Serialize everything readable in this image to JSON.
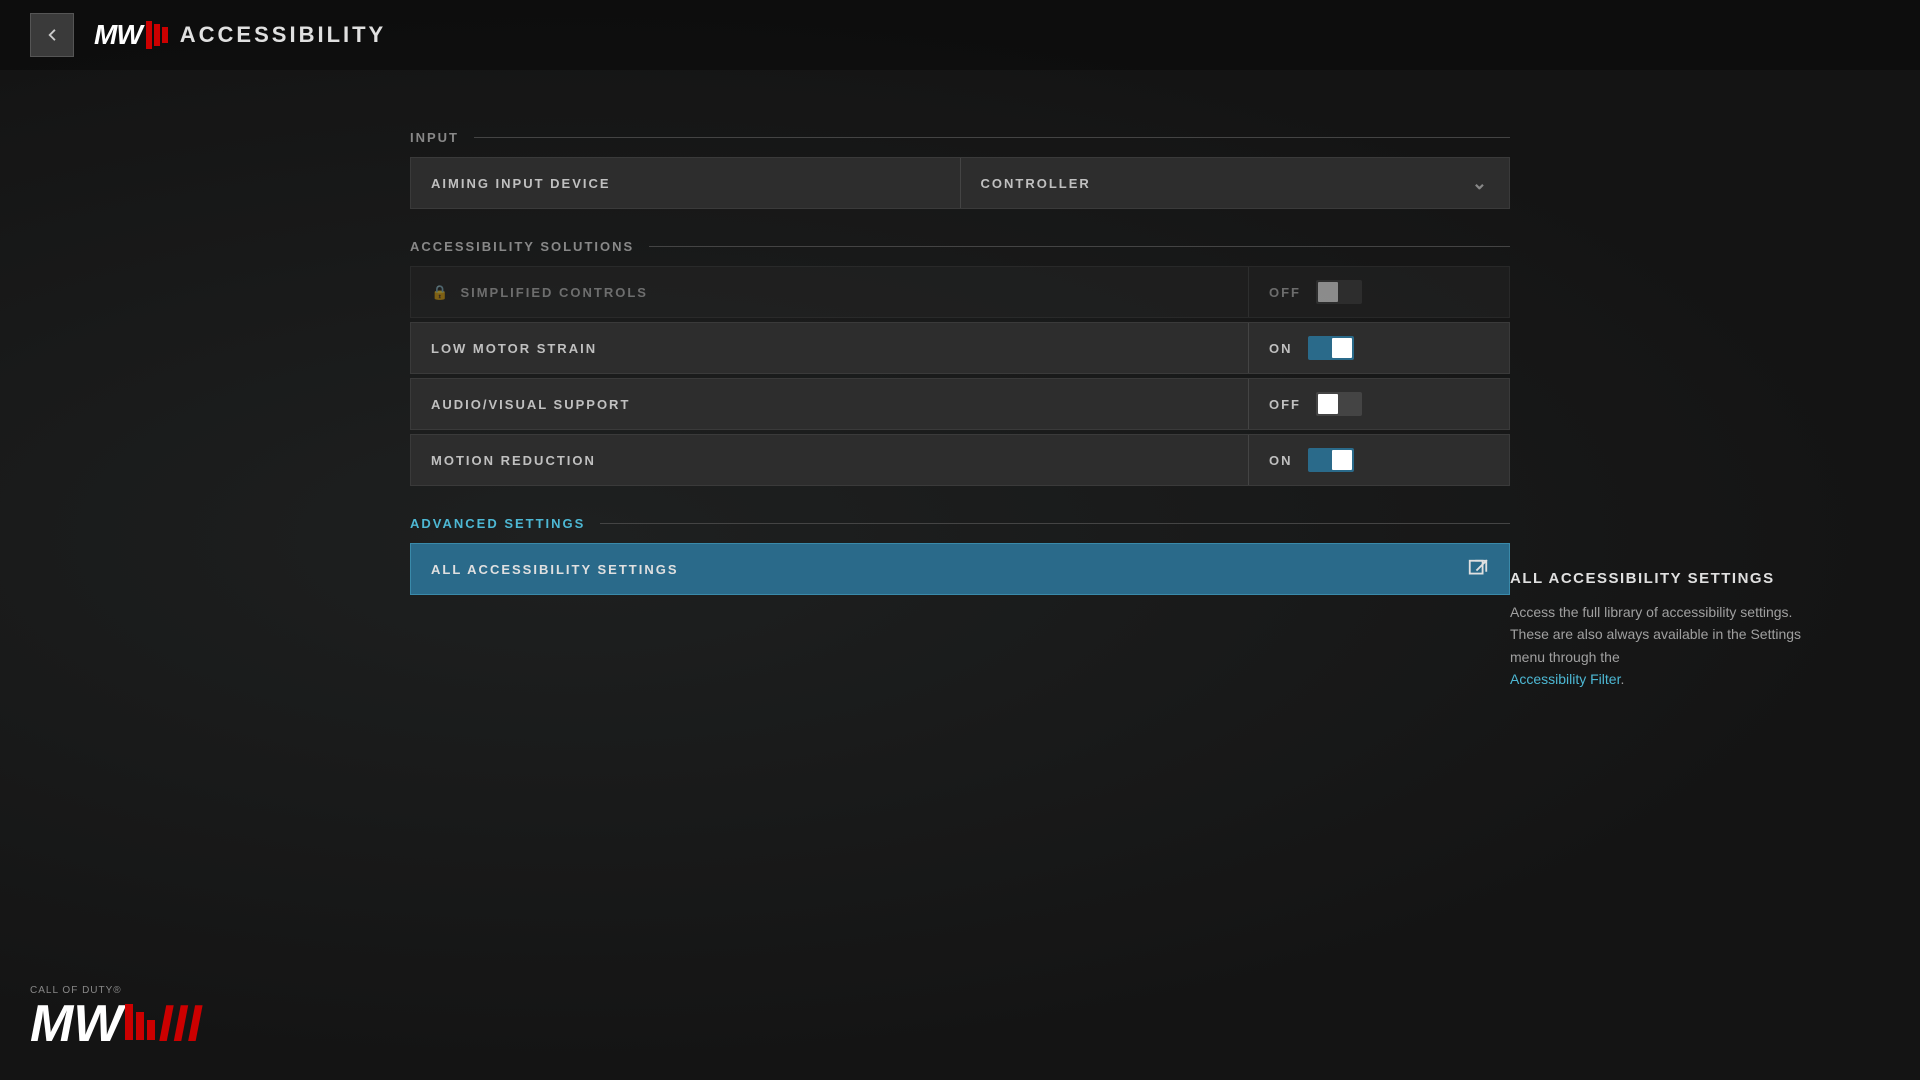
{
  "header": {
    "back_label": "←",
    "game_title": "MW",
    "page_title": "ACCESSIBILITY"
  },
  "sections": {
    "input": {
      "label": "INPUT",
      "settings": [
        {
          "name": "AIMING INPUT DEVICE",
          "value": "CONTROLLER",
          "type": "dropdown",
          "disabled": false
        }
      ]
    },
    "accessibility_solutions": {
      "label": "ACCESSIBILITY SOLUTIONS",
      "settings": [
        {
          "name": "SIMPLIFIED CONTROLS",
          "value": "OFF",
          "type": "toggle",
          "state": "off",
          "disabled": true,
          "locked": true
        },
        {
          "name": "LOW MOTOR STRAIN",
          "value": "ON",
          "type": "toggle",
          "state": "on",
          "disabled": false,
          "locked": false
        },
        {
          "name": "AUDIO/VISUAL SUPPORT",
          "value": "OFF",
          "type": "toggle",
          "state": "off",
          "disabled": false,
          "locked": false
        },
        {
          "name": "MOTION REDUCTION",
          "value": "ON",
          "type": "toggle",
          "state": "on",
          "disabled": false,
          "locked": false
        }
      ]
    },
    "advanced": {
      "label": "ADVANCED SETTINGS",
      "nav_items": [
        {
          "name": "ALL ACCESSIBILITY SETTINGS",
          "icon": "⧉"
        }
      ]
    }
  },
  "info_panel": {
    "title": "ALL ACCESSIBILITY SETTINGS",
    "body": "Access the full library of accessibility settings. These are also always available in the Settings menu through the",
    "link_text": "Accessibility Filter",
    "body_suffix": "."
  },
  "bottom_logo": {
    "cod_text": "CALL OF DUTY®",
    "mw_text": "MW",
    "iii_text": "III"
  }
}
